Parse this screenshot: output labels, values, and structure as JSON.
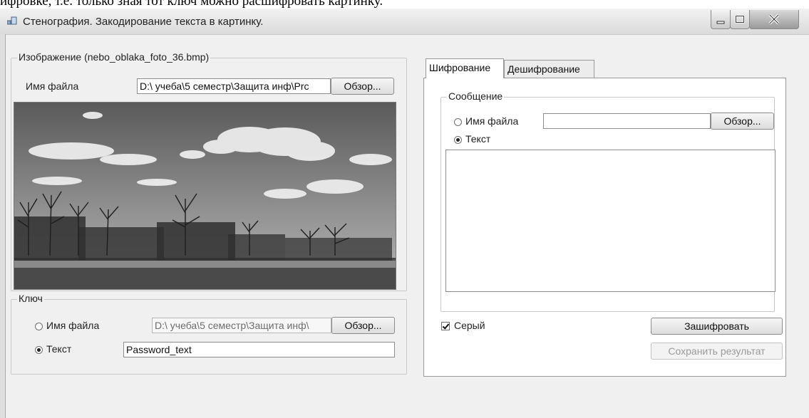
{
  "document": {
    "text_fragment": "ифровке, т.е. только зная тот ключ можно расшифровать картинку."
  },
  "window": {
    "title": "Стенография. Закодирование текста в картинку.",
    "icon": "app-window-icon",
    "controls": [
      "minimize-icon",
      "maximize-icon",
      "close-icon"
    ]
  },
  "image_group": {
    "legend": "Изображение (nebo_oblaka_foto_36.bmp)",
    "filename_label": "Имя файла",
    "filename_value": "D:\\ учеба\\5 семестр\\Защита инф\\Prc",
    "browse_label": "Обзор...",
    "preview": "landscape-photo"
  },
  "key_group": {
    "legend": "Ключ",
    "file_option_label": "Имя файла",
    "file_value": "D:\\ учеба\\5 семестр\\Защита инф\\",
    "browse_label": "Обзор...",
    "text_option_label": "Текст",
    "text_value": "Password_text",
    "selected": "text"
  },
  "tabs": [
    {
      "label": "Шифрование",
      "active": true
    },
    {
      "label": "Дешифрование",
      "active": false
    }
  ],
  "message_group": {
    "legend": "Сообщение",
    "file_option_label": "Имя файла",
    "file_value": "",
    "browse_label": "Обзор...",
    "text_option_label": "Текст",
    "selected": "text",
    "message_text": ""
  },
  "gray_checkbox": {
    "label": "Серый",
    "checked": true
  },
  "buttons": {
    "encrypt": "Зашифровать",
    "save_result": "Сохранить результат"
  },
  "colors": {
    "window_bg": "#f0f0f0",
    "panel_bg": "#ffffff",
    "border": "#8c8c8c",
    "disabled_text": "#9a9a9a"
  }
}
